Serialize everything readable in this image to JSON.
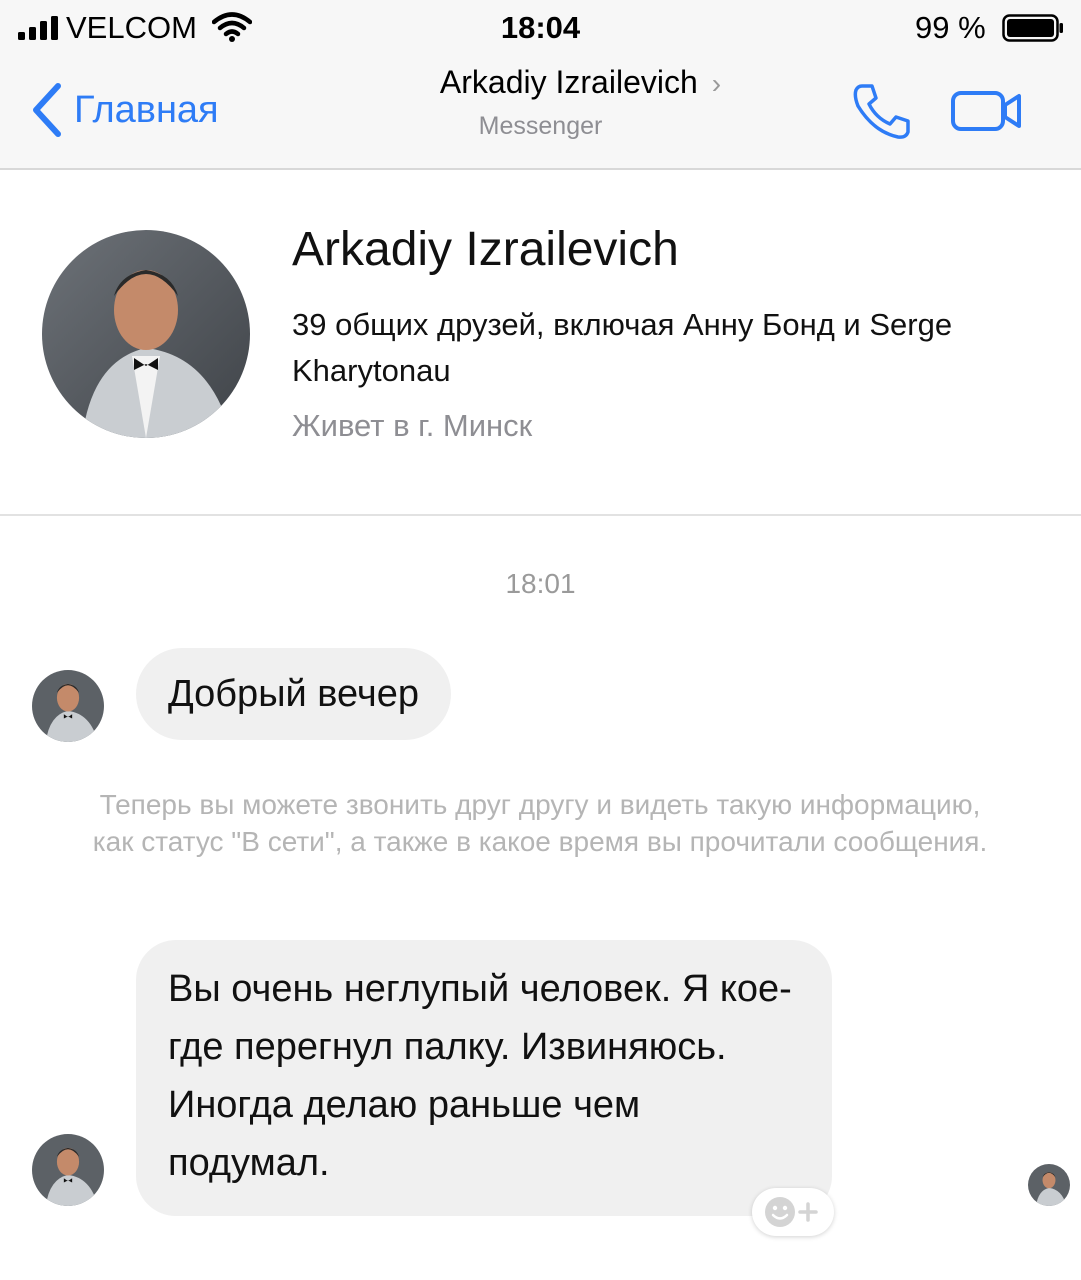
{
  "status_bar": {
    "carrier": "VELCOM",
    "time": "18:04",
    "battery_percent": "99 %"
  },
  "nav": {
    "back_label": "Главная",
    "title": "Arkadiy Izrailevich",
    "subtitle": "Messenger",
    "accent_color": "#2e7cf6"
  },
  "profile": {
    "name": "Arkadiy Izrailevich",
    "mutual_friends": "39 общих друзей, включая Анну Бонд и Serge Kharytonau",
    "location": "Живет в г. Минск"
  },
  "conversation": {
    "timestamp": "18:01",
    "messages": [
      {
        "text": "Добрый вечер"
      },
      {
        "text": "Вы очень неглупый человек. Я кое- где перегнул палку. Извиняюсь. Иногда делаю раньше чем подумал."
      }
    ],
    "notice": "Теперь вы можете звонить друг другу и видеть такую информацию, как статус \"В сети\", а также в какое время вы прочитали сообщения."
  },
  "icons": {
    "signal": "signal-icon",
    "wifi": "wifi-icon",
    "battery": "battery-icon",
    "back": "chevron-left-icon",
    "call": "phone-icon",
    "video": "video-camera-icon",
    "react": "emoji-add-icon"
  }
}
